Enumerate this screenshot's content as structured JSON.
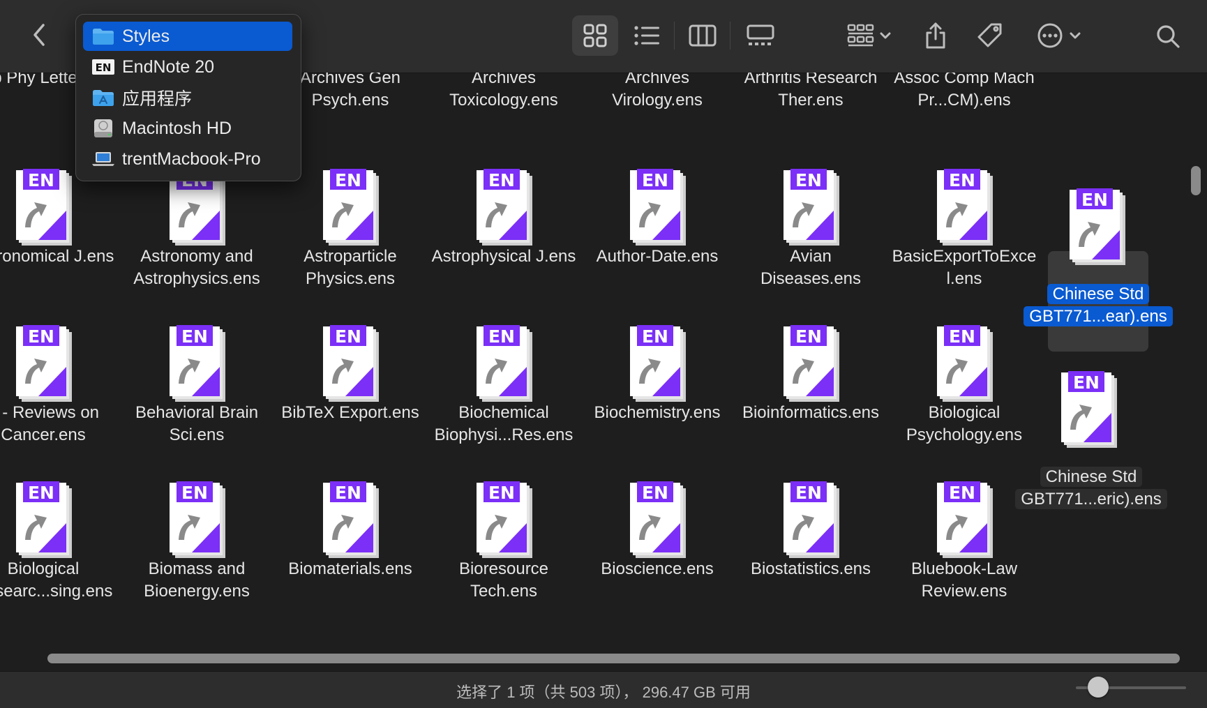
{
  "menu": {
    "items": [
      {
        "label": "Styles",
        "icon": "folder-icon",
        "selected": true
      },
      {
        "label": "EndNote 20",
        "icon": "endnote-app-icon",
        "selected": false
      },
      {
        "label": "应用程序",
        "icon": "applications-folder-icon",
        "selected": false
      },
      {
        "label": "Macintosh HD",
        "icon": "hard-drive-icon",
        "selected": false
      },
      {
        "label": "trentMacbook-Pro",
        "icon": "laptop-icon",
        "selected": false
      }
    ]
  },
  "toolbar": {
    "back_icon": "chevron-left-icon",
    "view_icon_grid": "grid-view-icon",
    "view_list": "list-view-icon",
    "view_columns": "column-view-icon",
    "view_gallery": "gallery-view-icon",
    "group_icon": "group-by-icon",
    "share_icon": "share-icon",
    "tag_icon": "tag-icon",
    "more_icon": "more-actions-icon",
    "search_icon": "search-icon"
  },
  "file_icon_badge": "EN",
  "files": [
    {
      "row": 0,
      "col": 0,
      "name": "App Phy Letters.en"
    },
    {
      "row": 0,
      "col": 2,
      "name": "Archives Gen Psych.ens"
    },
    {
      "row": 0,
      "col": 3,
      "name": "Archives Toxicology.ens"
    },
    {
      "row": 0,
      "col": 4,
      "name": "Archives Virology.ens"
    },
    {
      "row": 0,
      "col": 5,
      "name": "Arthritis Research Ther.ens"
    },
    {
      "row": 0,
      "col": 6,
      "name": "Assoc Comp Mach Pr...CM).ens"
    },
    {
      "row": 1,
      "col": 0,
      "name": "Astronomical J.ens"
    },
    {
      "row": 1,
      "col": 1,
      "name": "Astronomy and Astrophysics.ens"
    },
    {
      "row": 1,
      "col": 2,
      "name": "Astroparticle Physics.ens"
    },
    {
      "row": 1,
      "col": 3,
      "name": "Astrophysical J.ens"
    },
    {
      "row": 1,
      "col": 4,
      "name": "Author-Date.ens"
    },
    {
      "row": 1,
      "col": 5,
      "name": "Avian Diseases.ens"
    },
    {
      "row": 1,
      "col": 6,
      "name": "BasicExportToExcel.ens"
    },
    {
      "row": 2,
      "col": 0,
      "name": "A - Reviews on Cancer.ens"
    },
    {
      "row": 2,
      "col": 1,
      "name": "Behavioral Brain Sci.ens"
    },
    {
      "row": 2,
      "col": 2,
      "name": "BibTeX Export.ens"
    },
    {
      "row": 2,
      "col": 3,
      "name": "Biochemical Biophysi...Res.ens"
    },
    {
      "row": 2,
      "col": 4,
      "name": "Biochemistry.ens"
    },
    {
      "row": 2,
      "col": 5,
      "name": "Bioinformatics.ens"
    },
    {
      "row": 2,
      "col": 6,
      "name": "Biological Psychology.ens"
    },
    {
      "row": 3,
      "col": 0,
      "name": "Biological Researc...sing.ens"
    },
    {
      "row": 3,
      "col": 1,
      "name": "Biomass and Bioenergy.ens"
    },
    {
      "row": 3,
      "col": 2,
      "name": "Biomaterials.ens"
    },
    {
      "row": 3,
      "col": 3,
      "name": "Bioresource Tech.ens"
    },
    {
      "row": 3,
      "col": 4,
      "name": "Bioscience.ens"
    },
    {
      "row": 3,
      "col": 5,
      "name": "Biostatistics.ens"
    },
    {
      "row": 3,
      "col": 6,
      "name": "Bluebook-Law Review.ens"
    }
  ],
  "selected_file": {
    "name_line1": "Chinese Std",
    "name_line2": "GBT771...ear).ens"
  },
  "dragged_file": {
    "name_line1": "Chinese Std",
    "name_line2": "GBT771...eric).ens"
  },
  "status": {
    "text": "选择了 1 项（共 503 项）， 296.47 GB 可用"
  },
  "zoom_slider_value": 0.2,
  "colors": {
    "accent": "#0a5ad1",
    "file_purple": "#7b2ff7"
  }
}
